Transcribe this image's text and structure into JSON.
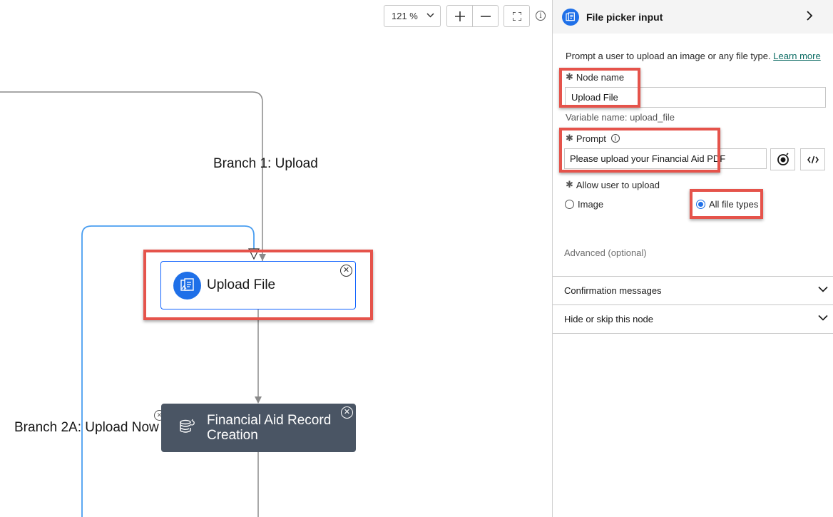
{
  "toolbar": {
    "zoom_value": "121 %",
    "zoom_in_icon": "plus-icon",
    "zoom_out_icon": "minus-icon",
    "fit_icon": "fit-to-screen-icon",
    "info_icon": "info-icon"
  },
  "canvas": {
    "branch1_label": "Branch 1: Upload",
    "branch2a_label": "Branch 2A: Upload Now",
    "nodes": [
      {
        "title": "Upload File",
        "icon": "file-picker-icon",
        "selected": true
      },
      {
        "title": "Financial Aid Record Creation",
        "icon": "database-sync-icon",
        "selected": false
      }
    ]
  },
  "panel": {
    "title": "File picker input",
    "icon": "file-picker-icon",
    "description": "Prompt a user to upload an image or any file type.",
    "learn_more": "Learn more",
    "node_name_label": "Node name",
    "node_name_value": "Upload File",
    "variable_name": "Variable name: upload_file",
    "prompt_label": "Prompt",
    "prompt_value": "Please upload your Financial Aid PDF",
    "allow_label": "Allow user to upload",
    "options": [
      {
        "label": "Image",
        "selected": false
      },
      {
        "label": "All file types",
        "selected": true
      }
    ],
    "advanced_label": "Advanced (optional)",
    "accordions": [
      "Confirmation messages",
      "Hide or skip this node"
    ]
  },
  "colors": {
    "accent": "#1f70e8",
    "highlight": "#e5534b",
    "node_dark": "#4a5564",
    "edge_blue": "#4a9ef0",
    "edge_gray": "#8a8a8a"
  }
}
